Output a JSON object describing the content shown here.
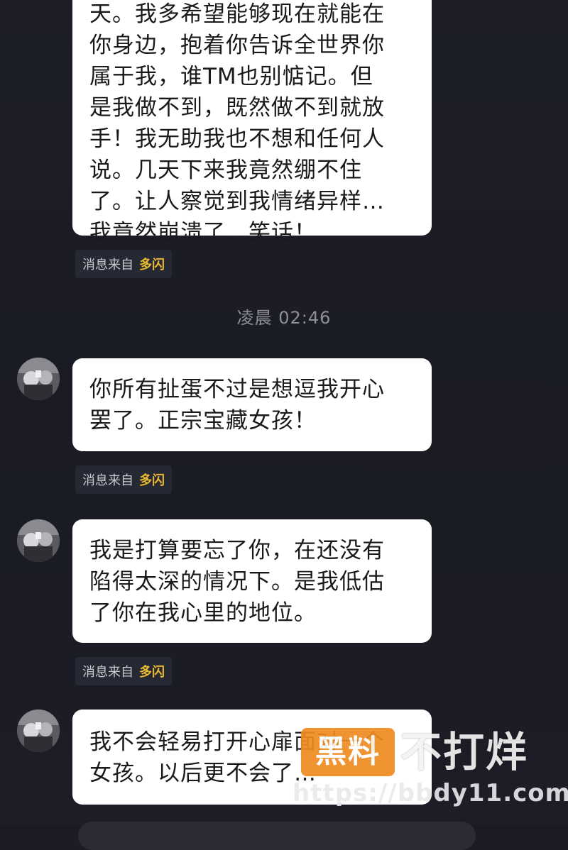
{
  "chat": {
    "messages": [
      {
        "lines": [
          "天。我多希望能够现在就能在",
          "你身边，抱着你告诉全世界你",
          "属于我，谁TM也别惦记。但",
          "是我做不到，既然做不到就放",
          "手！我无助我也不想和任何人",
          "说。几天下来我竟然绷不住",
          "了。让人察觉到我情绪异样…",
          "我竟然崩溃了…笑话！"
        ],
        "source_prefix": "消息来自",
        "source_app": "多闪"
      },
      {
        "lines": [
          "你所有扯蛋不过是想逗我开心",
          "罢了。正宗宝藏女孩！"
        ],
        "source_prefix": "消息来自",
        "source_app": "多闪"
      },
      {
        "lines": [
          "我是打算要忘了你，在还没有",
          "陷得太深的情况下。是我低估",
          "了你在我心里的地位。"
        ],
        "source_prefix": "消息来自",
        "source_app": "多闪"
      },
      {
        "lines": [
          "我不会轻易打开心扉面对一个",
          "女孩。以后更不会了…"
        ]
      }
    ],
    "timestamp": "凌晨 02:46"
  },
  "watermark": {
    "badge": "黑料",
    "name": "不打烊",
    "url": "https://bbdy11.com"
  },
  "colors": {
    "background": "#1b1c24",
    "bubble": "#ffffff",
    "source_app": "#e8b832",
    "watermark_badge": "#ee8b1f"
  }
}
